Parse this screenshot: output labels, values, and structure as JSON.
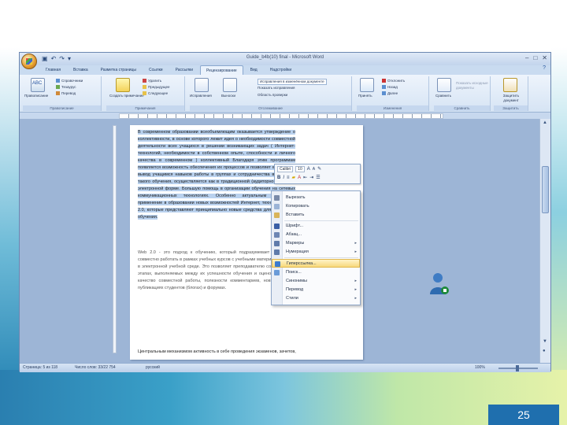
{
  "slide": {
    "number": "25"
  },
  "window": {
    "title": "Guide_b4b(10) final - Microsoft Word",
    "qat_icons": [
      "save-icon",
      "undo-icon",
      "redo-icon"
    ]
  },
  "ribbon": {
    "tabs": [
      "Главная",
      "Вставка",
      "Разметка страницы",
      "Ссылки",
      "Рассылки",
      "Рецензирование",
      "Вид",
      "Надстройки"
    ],
    "active_tab_index": 5,
    "groups": [
      {
        "name": "Правописание",
        "buttons": [
          "Правописание",
          "Справочники",
          "Тезаурус",
          "Перевод"
        ]
      },
      {
        "name": "Примечания",
        "buttons": [
          "Создать примечание",
          "Удалить",
          "Предыдущее",
          "Следующее"
        ]
      },
      {
        "name": "Отслеживание",
        "buttons": [
          "Исправления",
          "Выноски",
          "Исправления в изменённом документе",
          "Показать исправления",
          "Область проверки"
        ]
      },
      {
        "name": "Изменения",
        "buttons": [
          "Принять",
          "Отклонить",
          "Назад",
          "Далее"
        ]
      },
      {
        "name": "Сравнить",
        "buttons": [
          "Сравнить",
          "Показать исходные документы"
        ]
      },
      {
        "name": "Защитить",
        "buttons": [
          "Защитить документ"
        ]
      }
    ]
  },
  "document": {
    "para1": "В современном образовании всеобъемлющим оказывается утверждение о коллективности, в основе которого лежит идея о необходимости совместной деятельности всех учащихся в решении возникающих задач ( Интернет-технологий, необходимости в собственном опыте, способности и личного качества в современном ) коллективный Благодаря этим программам появляется возможность обеспечения их процессов и позволяет выполнить, вывод учащимся навыков работы в группах и сотрудничества в процессе такого обучения, осуществляется как в традиционной (аудиторной), так и в электронной форме. Большую помощь в организации обучения на сетевых коммуникационных технологиях. Особенно актуальным становится применение в образовании новых возможностей Интернет, технологий Web 2.0, которые представляют принципиально новые средства для общения и обучения.",
    "para2": "Web 2.0 - это подход к обучению, который подразумевает инструменты, позволяющие студентам совместно работать в рамках учебных курсов с учебными материалами и публикациями, непосредственно в электронной учебной среде. Это позволяет преподавателю создать среду конкуренции знаний на всех этапах, выполняемых между их успешности обучения и оценок, выставляемых всеми участниками за качество совместной работы, полезности комментариев, новых идей, изложенных в персональных публикациях студентов (блогах) и форумах.",
    "para3": "Центральным механизмом активность в себе проведения экзаменов, зачетов,"
  },
  "mini_toolbar": {
    "font": "Calibri",
    "size": "10",
    "glyphs": [
      "A",
      "A",
      "A",
      "B",
      "I",
      "A"
    ]
  },
  "context_menu": {
    "items": [
      {
        "label": "Вырезать",
        "icon": "cut-icon",
        "arrow": false
      },
      {
        "label": "Копировать",
        "icon": "copy-icon",
        "arrow": false
      },
      {
        "label": "Вставить",
        "icon": "paste-icon",
        "arrow": false
      },
      {
        "label": "Шрифт...",
        "icon": "font-icon",
        "arrow": false
      },
      {
        "label": "Абзац...",
        "icon": "paragraph-icon",
        "arrow": false
      },
      {
        "label": "Маркеры",
        "icon": "bullets-icon",
        "arrow": true
      },
      {
        "label": "Нумерация",
        "icon": "numbering-icon",
        "arrow": true
      },
      {
        "label": "Гиперссылка...",
        "icon": "hyperlink-icon",
        "arrow": false,
        "selected": true
      },
      {
        "label": "Поиск...",
        "icon": "search-icon",
        "arrow": false
      },
      {
        "label": "Синонимы",
        "icon": "synonyms-icon",
        "arrow": true
      },
      {
        "label": "Перевод",
        "icon": "translate-icon",
        "arrow": true
      },
      {
        "label": "Стили",
        "icon": "styles-icon",
        "arrow": true
      }
    ]
  },
  "status_bar": {
    "page": "Страница: 5 из 118",
    "words": "Число слов: 33/22 754",
    "language": "русский",
    "zoom": "100%"
  }
}
